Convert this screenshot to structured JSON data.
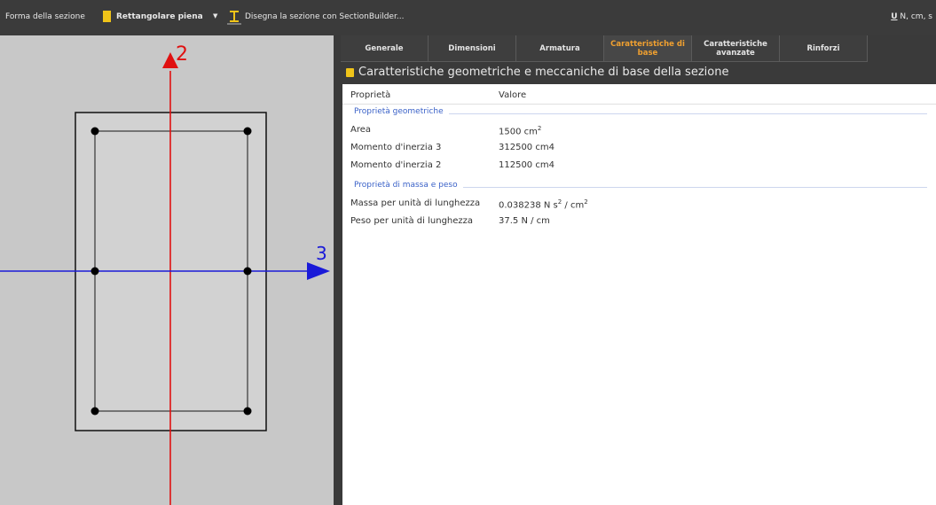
{
  "toolbar": {
    "section_shape_label": "Forma della sezione",
    "section_shape_value": "Rettangolare piena",
    "section_builder_label": "Disegna la sezione con SectionBuilder...",
    "units_icon": "U",
    "units_text": "N, cm, s"
  },
  "canvas": {
    "axis_vertical_label": "2",
    "axis_horizontal_label": "3",
    "axis_vertical_color": "#e01010",
    "axis_horizontal_color": "#1a1ad8"
  },
  "tabs": [
    {
      "label": "Generale",
      "active": false
    },
    {
      "label": "Dimensioni",
      "active": false
    },
    {
      "label": "Armatura",
      "active": false
    },
    {
      "label": "Caratteristiche di base",
      "active": true
    },
    {
      "label": "Caratteristiche avanzate",
      "active": false
    },
    {
      "label": "Rinforzi",
      "active": false
    }
  ],
  "panel": {
    "title": "Caratteristiche geometriche e meccaniche di base della sezione",
    "col_property": "Proprietà",
    "col_value": "Valore",
    "group_geometric": "Proprietà geometriche",
    "group_mass": "Proprietà di massa e peso",
    "rows": [
      {
        "name": "Area",
        "value": "1500 cm",
        "sup": "2"
      },
      {
        "name": "Momento d'inerzia 3",
        "value": "312500 cm4"
      },
      {
        "name": "Momento d'inerzia 2",
        "value": "112500 cm4"
      },
      {
        "name": "Massa per unità di lunghezza",
        "value_a": "0.038238 N s",
        "sup_a": "2",
        "value_b": " / cm",
        "sup_b": "2"
      },
      {
        "name": "Peso per unità di lunghezza",
        "value": "37.5 N / cm"
      }
    ]
  },
  "colors": {
    "active_tab": "#f0a030",
    "group_text": "#3b62c8",
    "accent_icon": "#f0c419"
  }
}
